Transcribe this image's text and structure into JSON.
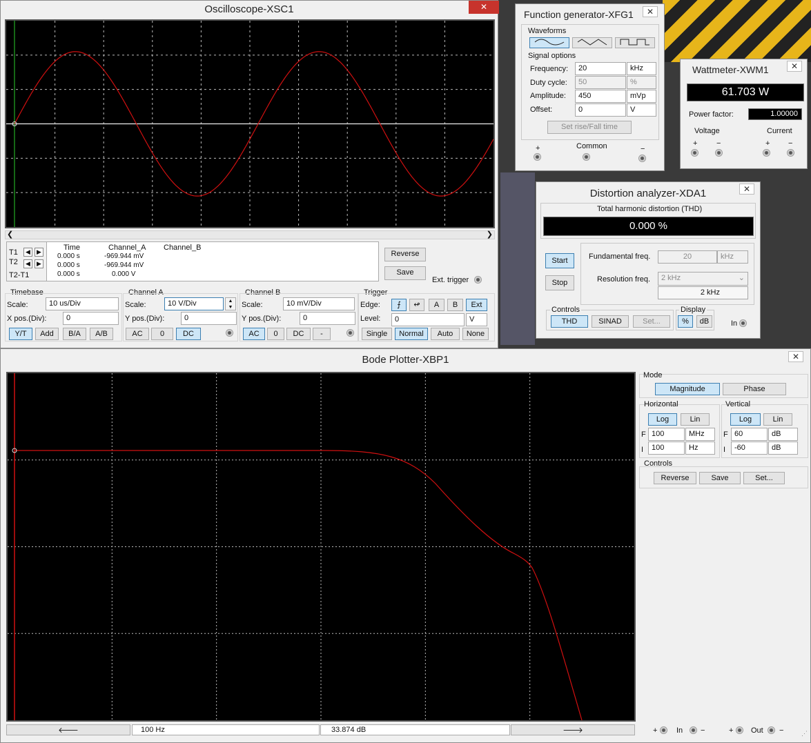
{
  "oscilloscope": {
    "title": "Oscilloscope-XSC1",
    "close": "✕",
    "readout": {
      "headers": [
        "Time",
        "Channel_A",
        "Channel_B"
      ],
      "rows": [
        {
          "label": "T1",
          "time": "0.000 s",
          "a": "-969.944 mV",
          "b": ""
        },
        {
          "label": "T2",
          "time": "0.000 s",
          "a": "-969.944 mV",
          "b": ""
        },
        {
          "label": "T2-T1",
          "time": "0.000 s",
          "a": "0.000 V",
          "b": ""
        }
      ]
    },
    "reverse": "Reverse",
    "save": "Save",
    "ext_trigger": "Ext. trigger",
    "timebase": {
      "title": "Timebase",
      "scale_label": "Scale:",
      "scale": "10 us/Div",
      "xpos_label": "X pos.(Div):",
      "xpos": "0",
      "modes": [
        "Y/T",
        "Add",
        "B/A",
        "A/B"
      ]
    },
    "channel_a": {
      "title": "Channel A",
      "scale_label": "Scale:",
      "scale": "10  V/Div",
      "ypos_label": "Y pos.(Div):",
      "ypos": "0",
      "coupling": [
        "AC",
        "0",
        "DC"
      ]
    },
    "channel_b": {
      "title": "Channel B",
      "scale_label": "Scale:",
      "scale": "10 mV/Div",
      "ypos_label": "Y pos.(Div):",
      "ypos": "0",
      "coupling": [
        "AC",
        "0",
        "DC",
        "-"
      ]
    },
    "trigger": {
      "title": "Trigger",
      "edge_label": "Edge:",
      "sources": [
        "A",
        "B",
        "Ext"
      ],
      "level_label": "Level:",
      "level": "0",
      "level_unit": "V",
      "modes": [
        "Single",
        "Normal",
        "Auto",
        "None"
      ]
    },
    "trace_color": "#d01010"
  },
  "function_generator": {
    "title": "Function generator-XFG1",
    "close": "✕",
    "waveforms_label": "Waveforms",
    "signal_options_label": "Signal options",
    "rows": [
      {
        "label": "Frequency:",
        "value": "20",
        "unit": "kHz"
      },
      {
        "label": "Duty cycle:",
        "value": "50",
        "unit": "%"
      },
      {
        "label": "Amplitude:",
        "value": "450",
        "unit": "mVp"
      },
      {
        "label": "Offset:",
        "value": "0",
        "unit": "V"
      }
    ],
    "rise_fall": "Set rise/Fall time",
    "plus": "+",
    "common": "Common",
    "minus": "−"
  },
  "wattmeter": {
    "title": "Wattmeter-XWM1",
    "close": "✕",
    "reading": "61.703 W",
    "pf_label": "Power factor:",
    "pf": "1.00000",
    "voltage": "Voltage",
    "current": "Current",
    "plus": "+",
    "minus": "−"
  },
  "distortion": {
    "title": "Distortion analyzer-XDA1",
    "close": "✕",
    "thd_label": "Total harmonic distortion (THD)",
    "thd": "0.000 %",
    "start": "Start",
    "stop": "Stop",
    "fund_label": "Fundamental freq.",
    "fund": "20",
    "fund_unit": "kHz",
    "res_label": "Resolution freq.",
    "res": "2 kHz",
    "res_value": "2 kHz",
    "controls_label": "Controls",
    "controls": [
      "THD",
      "SINAD",
      "Set..."
    ],
    "display_label": "Display",
    "display": [
      "%",
      "dB"
    ],
    "in": "In"
  },
  "bode": {
    "title": "Bode Plotter-XBP1",
    "close": "✕",
    "mode_label": "Mode",
    "modes": [
      "Magnitude",
      "Phase"
    ],
    "horizontal_label": "Horizontal",
    "vertical_label": "Vertical",
    "scale_btns": [
      "Log",
      "Lin"
    ],
    "h_f": {
      "prefix": "F",
      "value": "100",
      "unit": "MHz"
    },
    "h_i": {
      "prefix": "I",
      "value": "100",
      "unit": "Hz"
    },
    "v_f": {
      "prefix": "F",
      "value": "60",
      "unit": "dB"
    },
    "v_i": {
      "prefix": "I",
      "value": "-60",
      "unit": "dB"
    },
    "controls_label": "Controls",
    "controls": [
      "Reverse",
      "Save",
      "Set..."
    ],
    "left_arrow": "🡐",
    "right_arrow": "🡒",
    "freq_readout": "100  Hz",
    "gain_readout": "33.874 dB",
    "in": "In",
    "out": "Out",
    "plus": "+",
    "minus": "−",
    "trace_color": "#d01010"
  }
}
